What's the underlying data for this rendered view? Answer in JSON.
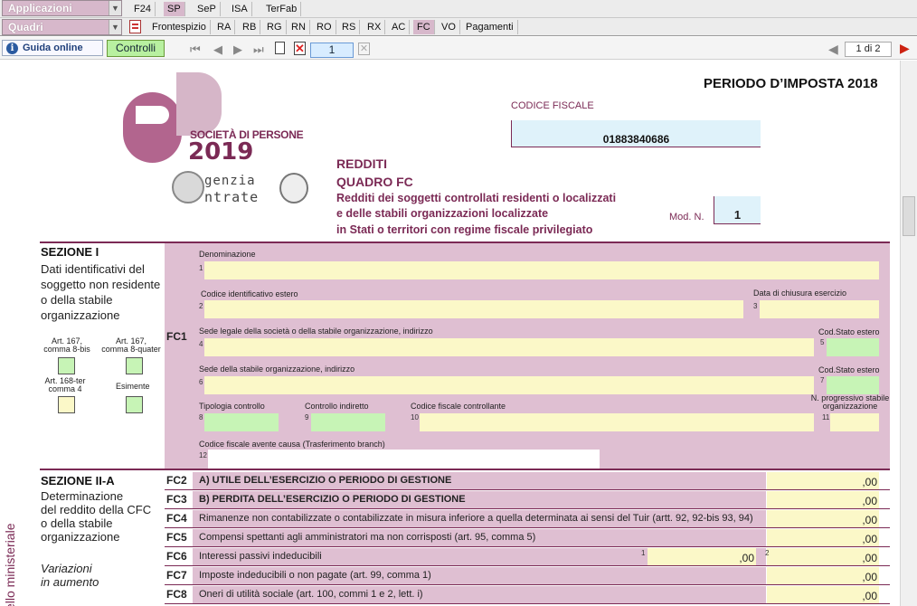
{
  "toolbar": {
    "applicazioni": "Applicazioni",
    "quadri": "Quadri",
    "top_tabs": [
      "F24",
      "SP",
      "SeP",
      "ISA",
      "TerFab"
    ],
    "quadri_tabs": [
      "Frontespizio",
      "RA",
      "RB",
      "RG",
      "RN",
      "RO",
      "RS",
      "RX",
      "AC",
      "FC",
      "VO",
      "Pagamenti"
    ],
    "guida": "Guida online",
    "controlli": "Controlli",
    "page_current": "1",
    "page_count": "1 di 2"
  },
  "header": {
    "logo_title": "SOCIETÀ DI PERSONE",
    "logo_year": "2019",
    "agenzia_a": "genzia",
    "agenzia_b": "ntrate",
    "periodo": "PERIODO D’IMPOSTA 2018",
    "codice_fiscale_label": "CODICE FISCALE",
    "codice_fiscale": "01883840686",
    "redditi": "REDDITI",
    "quadro": "QUADRO FC",
    "desc1": "Redditi dei soggetti controllati residenti o localizzati",
    "desc2": "e delle stabili organizzazioni localizzate",
    "desc3": "in Stati o territori con regime fiscale privilegiato",
    "mod_label": "Mod. N.",
    "mod_value": "1"
  },
  "sezione1": {
    "title": "SEZIONE I",
    "desc": [
      "Dati identificativi del",
      "soggetto non residente",
      "o della stabile",
      "organizzazione"
    ],
    "code": "FC1",
    "art167a": [
      "Art. 167,",
      "comma 8-bis"
    ],
    "art167b": [
      "Art. 167,",
      "comma 8-quater"
    ],
    "art168": [
      "Art. 168-ter",
      "comma 4"
    ],
    "esimente": "Esimente",
    "denominazione": "Denominazione",
    "codice_estero": "Codice identificativo estero",
    "data_chiusura": "Data di chiusura esercizio",
    "sede_legale": "Sede legale della società o della stabile organizzazione, indirizzo",
    "cod_stato1": "Cod.Stato estero",
    "sede_stabile": "Sede della stabile organizzazione, indirizzo",
    "cod_stato2": "Cod.Stato estero",
    "tipologia": "Tipologia controllo",
    "controllo_indiretto": "Controllo indiretto",
    "cf_controllante": "Codice fiscale controllante",
    "n_progressivo": [
      "N. progressivo stabile",
      "organizzazione"
    ],
    "cf_avente_causa": "Codice fiscale avente causa (Trasferimento branch)",
    "field_nums": [
      "1",
      "2",
      "3",
      "4",
      "5",
      "6",
      "7",
      "8",
      "9",
      "10",
      "11",
      "12"
    ]
  },
  "sezione2": {
    "title": "SEZIONE II-A",
    "desc": [
      "Determinazione",
      "del reddito della CFC",
      "o della stabile",
      "organizzazione"
    ],
    "variazioni": [
      "Variazioni",
      "in aumento"
    ],
    "side": "ello ministeriale",
    "rows": [
      {
        "code": "FC2",
        "text": "A) UTILE DELL’ESERCIZIO O PERIODO DI GESTIONE",
        "value": ",00",
        "bold": true
      },
      {
        "code": "FC3",
        "text": "B) PERDITA DELL’ESERCIZIO O PERIODO DI GESTIONE",
        "value": ",00",
        "bold": true
      },
      {
        "code": "FC4",
        "text": "Rimanenze non contabilizzate o contabilizzate in misura inferiore a quella determinata ai sensi del Tuir (artt. 92, 92-bis 93, 94)",
        "value": ",00",
        "bold": false
      },
      {
        "code": "FC5",
        "text": "Compensi spettanti agli amministratori ma non corrisposti (art. 95, comma 5)",
        "value": ",00",
        "bold": false
      },
      {
        "code": "FC6",
        "text": "Interessi passivi indeducibili",
        "value": ",00",
        "bold": false,
        "sub_value": ",00",
        "sub_num1": "1",
        "sub_num2": "2"
      },
      {
        "code": "FC7",
        "text": "Imposte indeducibili o non pagate (art. 99, comma 1)",
        "value": ",00",
        "bold": false
      },
      {
        "code": "FC8",
        "text": "Oneri di utilità sociale (art. 100, commi 1 e 2, lett. i)",
        "value": ",00",
        "bold": false
      }
    ]
  }
}
